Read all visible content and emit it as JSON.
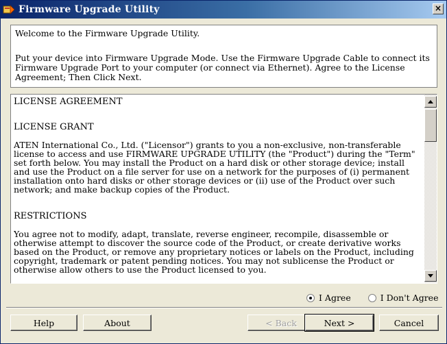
{
  "window": {
    "title": "Firmware Upgrade Utility",
    "close_glyph": "×"
  },
  "welcome": {
    "line1": "Welcome to the Firmware Upgrade Utility.",
    "line2": "Put your device into Firmware Upgrade Mode. Use the Firmware Upgrade Cable to connect its Firmware Upgrade Port to your computer (or connect via Ethernet). Agree to the License Agreement; Then Click Next."
  },
  "license": {
    "heading": "LICENSE AGREEMENT",
    "grant_heading": "LICENSE GRANT",
    "grant_text": "ATEN International Co., Ltd. (\"Licensor\") grants to you a non-exclusive, non-transferable license to access and use FIRMWARE UPGRADE UTILITY (the \"Product\") during the \"Term\" set forth below. You may install the Product on a hard disk or other storage device; install and use the Product on a file server for use on a network for the purposes of (i) permanent installation onto hard disks or other storage devices or (ii) use of the Product over such network; and make backup copies of the Product.",
    "restrictions_heading": "RESTRICTIONS",
    "restrictions_text": "You agree not to modify, adapt, translate, reverse engineer, recompile, disassemble or otherwise attempt to discover the source code of the Product, or create derivative works based on the Product, or remove any proprietary notices or labels on the Product, including copyright, trademark or patent pending notices. You may not sublicense the Product or otherwise allow others to use the Product licensed to you."
  },
  "agreement": {
    "agree_label": "I Agree",
    "disagree_label": "I Don't Agree",
    "selected": "agree"
  },
  "buttons": {
    "help": "Help",
    "about": "About",
    "back": "< Back",
    "next": "Next >",
    "cancel": "Cancel"
  },
  "colors": {
    "title_start": "#0a246a",
    "title_end": "#a6caf0",
    "face": "#ece9d8"
  },
  "icons": {
    "title": "firmware-app-icon",
    "scroll_up": "triangle-up-icon",
    "scroll_down": "triangle-down-icon"
  }
}
